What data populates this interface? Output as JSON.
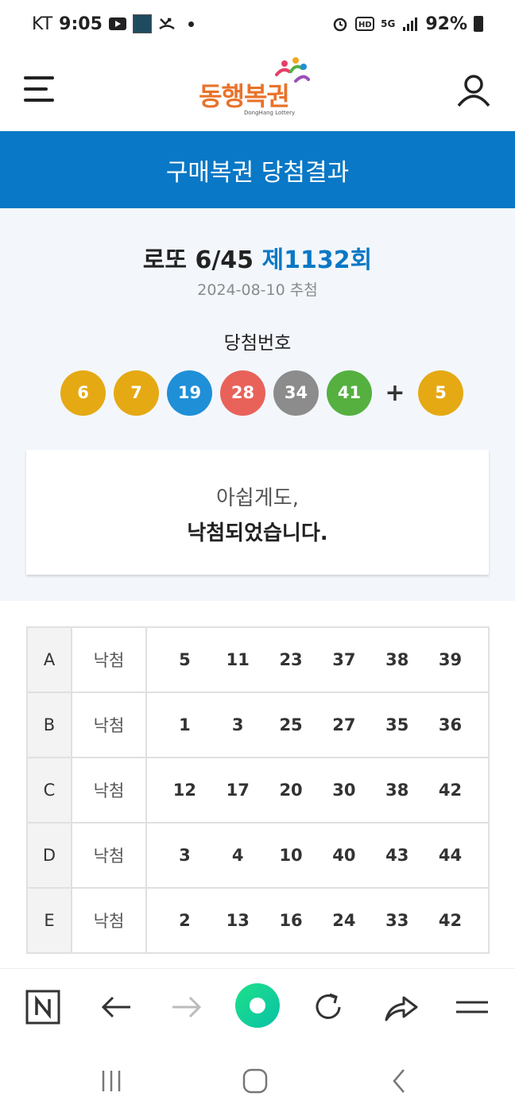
{
  "status_bar": {
    "carrier": "KT",
    "time": "9:05",
    "network": "5G",
    "battery": "92%"
  },
  "header": {
    "logo_text": "동행복권",
    "logo_sub": "DongHang Lottery"
  },
  "title_bar": {
    "title": "구매복권 당첨결과"
  },
  "draw": {
    "game": "로또 6/45",
    "round": "제1132회",
    "date": "2024-08-10 추첨",
    "numbers_label": "당첨번호",
    "numbers": [
      "6",
      "7",
      "19",
      "28",
      "34",
      "41"
    ],
    "bonus": "5",
    "ball_colors": {
      "yellow": "#e5a914",
      "blue": "#1f8fd7",
      "red": "#e9625a",
      "gray": "#8c8c8c",
      "green": "#55b040"
    }
  },
  "result_card": {
    "line1": "아쉽게도,",
    "line2": "낙첨되었습니다."
  },
  "games": [
    {
      "slot": "A",
      "status": "낙첨",
      "numbers": [
        "5",
        "11",
        "23",
        "37",
        "38",
        "39"
      ]
    },
    {
      "slot": "B",
      "status": "낙첨",
      "numbers": [
        "1",
        "3",
        "25",
        "27",
        "35",
        "36"
      ]
    },
    {
      "slot": "C",
      "status": "낙첨",
      "numbers": [
        "12",
        "17",
        "20",
        "30",
        "38",
        "42"
      ]
    },
    {
      "slot": "D",
      "status": "낙첨",
      "numbers": [
        "3",
        "4",
        "10",
        "40",
        "43",
        "44"
      ]
    },
    {
      "slot": "E",
      "status": "낙첨",
      "numbers": [
        "2",
        "13",
        "16",
        "24",
        "33",
        "42"
      ]
    }
  ],
  "browser_bar": {
    "icons": [
      "naver-home-icon",
      "back-arrow-icon",
      "forward-arrow-icon",
      "green-dot-icon",
      "refresh-icon",
      "share-icon",
      "menu-icon"
    ]
  },
  "nav_bar": {
    "icons": [
      "recent-apps-icon",
      "home-icon",
      "back-icon"
    ]
  }
}
